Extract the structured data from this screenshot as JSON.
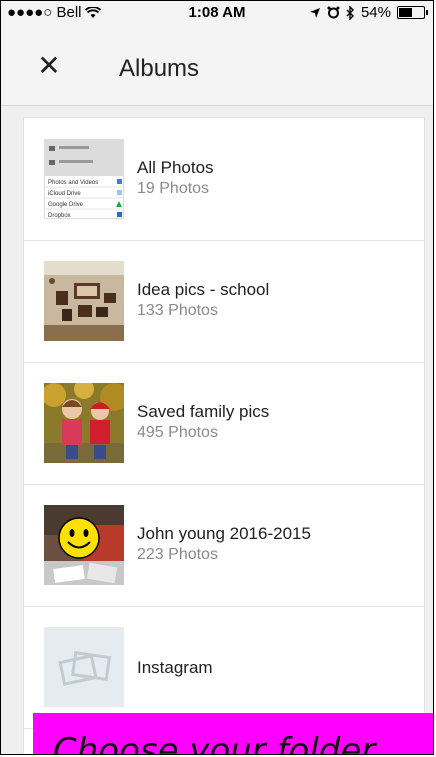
{
  "status_bar": {
    "carrier": "●●●●○ Bell",
    "time": "1:08 AM",
    "battery": "54%",
    "battery_level": 0.54
  },
  "app_bar": {
    "close_glyph": "✕",
    "title": "Albums"
  },
  "albums": [
    {
      "name": "All Photos",
      "count": "19 Photos",
      "thumb": "screenshot-thumb"
    },
    {
      "name": "Idea pics - school",
      "count": "133 Photos",
      "thumb": "wall-frames-thumb"
    },
    {
      "name": "Saved family pics",
      "count": "495 Photos",
      "thumb": "kids-autumn-thumb"
    },
    {
      "name": "John young 2016-2015",
      "count": "223 Photos",
      "thumb": "kid-smiley-thumb"
    },
    {
      "name": "Instagram",
      "count": "",
      "thumb": "placeholder-thumb"
    }
  ],
  "thumb_all_photos": {
    "lines": [
      "Photos and Videos",
      "iCloud Drive",
      "Google Drive",
      "Dropbox"
    ]
  },
  "banner": {
    "text": "Choose your folder",
    "color": "#ff00ff"
  }
}
